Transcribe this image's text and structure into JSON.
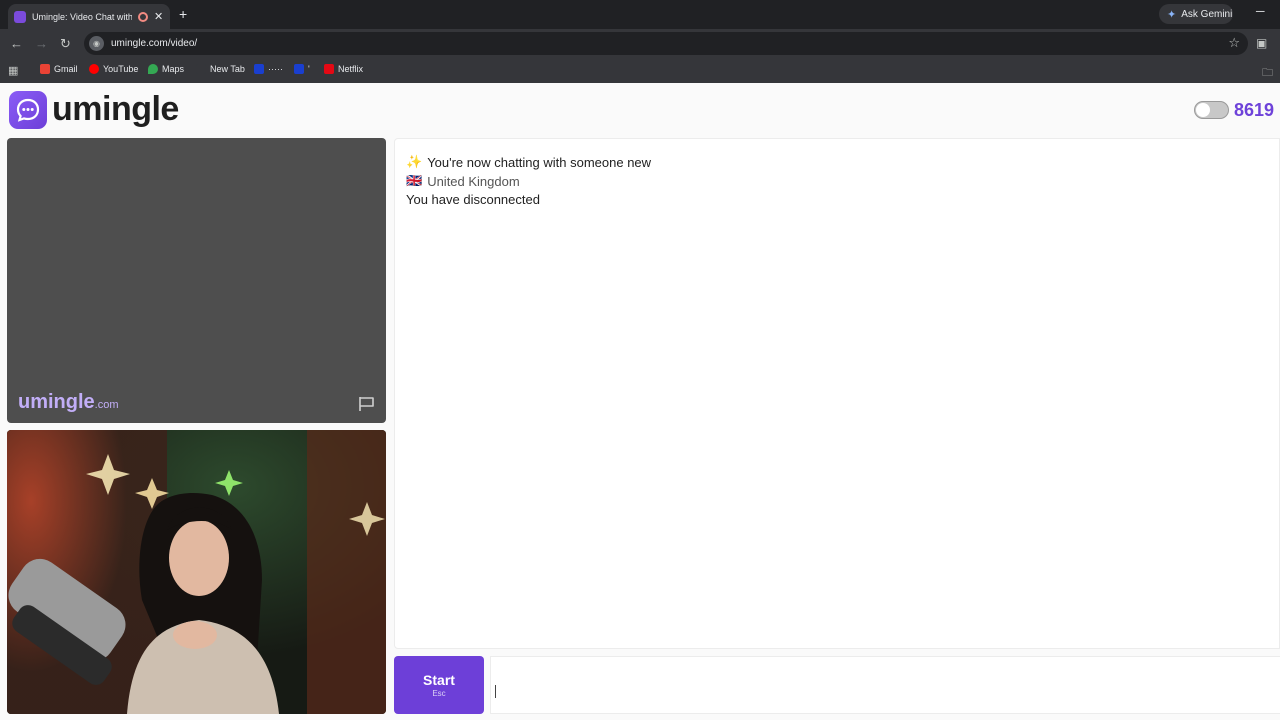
{
  "browser": {
    "tab_title": "Umingle: Video Chat with S",
    "new_tab_symbol": "+",
    "ask_gemini": "Ask Gemini",
    "url": "umingle.com/video/",
    "bookmarks": [
      {
        "label": "Gmail",
        "color": "#ea4335"
      },
      {
        "label": "YouTube",
        "color": "#ff0000"
      },
      {
        "label": "Maps",
        "color": "#34a853"
      },
      {
        "label": "New Tab",
        "color": "#35363a"
      },
      {
        "label": "·····",
        "color": "#1a3fcf"
      },
      {
        "label": "'",
        "color": "#1a3fcf"
      },
      {
        "label": "Netflix",
        "color": "#e50914"
      }
    ]
  },
  "site": {
    "logo_text": "umingle",
    "user_count": "8619",
    "watermark": "umingle",
    "watermark_suffix": ".com",
    "brand_color": "#6d3fd8"
  },
  "chat": {
    "messages": [
      {
        "icon": "✨",
        "text": "You're now chatting with someone new"
      },
      {
        "icon": "🇬🇧",
        "text": "United Kingdom"
      },
      {
        "icon": "",
        "text": "You have disconnected"
      }
    ]
  },
  "controls": {
    "start_label": "Start",
    "start_hint": "Esc",
    "chat_input_placeholder": ""
  }
}
